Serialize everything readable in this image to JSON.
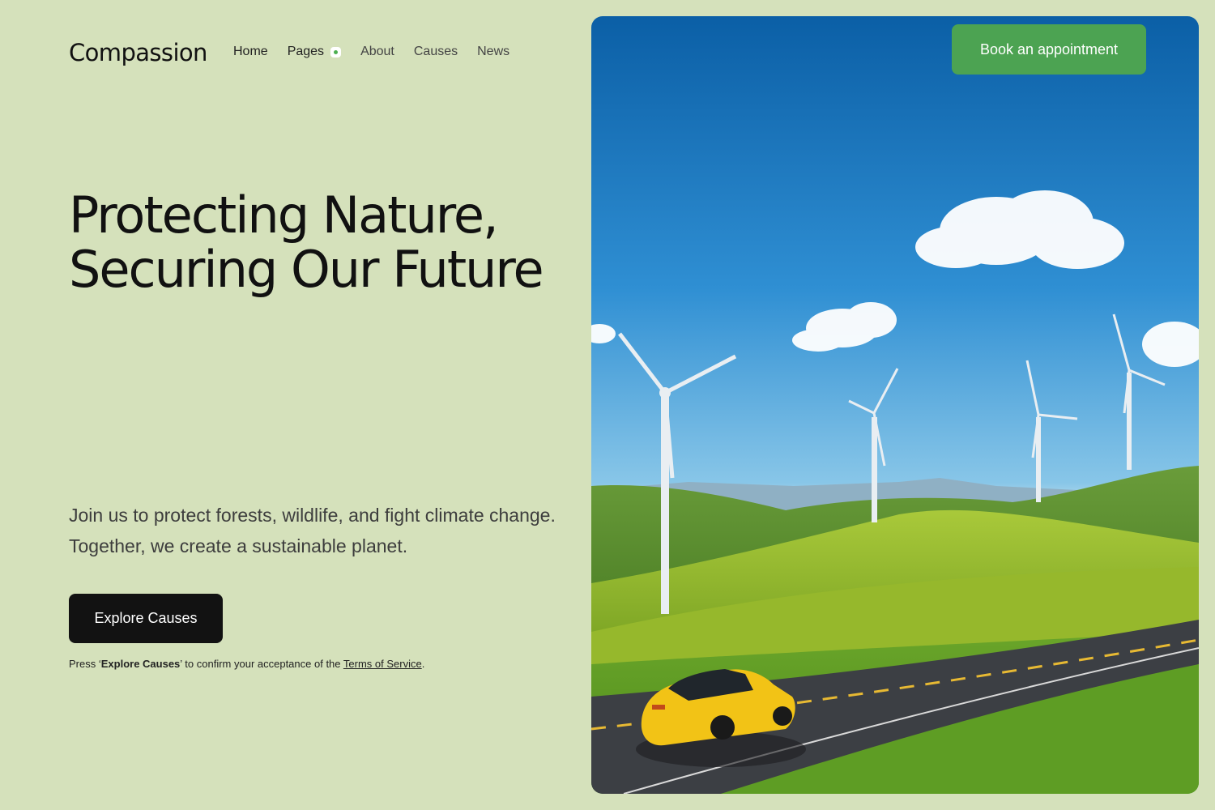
{
  "brand": {
    "name": "Compassion"
  },
  "nav": {
    "items": [
      {
        "label": "Home"
      },
      {
        "label": "Pages"
      },
      {
        "label": "About"
      },
      {
        "label": "Causes"
      },
      {
        "label": "News"
      }
    ]
  },
  "header": {
    "cta_label": "Book an appointment"
  },
  "hero": {
    "title_line1": "Protecting Nature,",
    "title_line2": "Securing Our Future",
    "subtitle_line1": "Join us to protect forests, wildlife, and fight climate change.",
    "subtitle_line2": "Together, we create a sustainable planet.",
    "cta_label": "Explore Causes",
    "terms_prefix": "Press ‘",
    "terms_cta": "Explore Causes",
    "terms_middle": "’ to confirm your acceptance of the ",
    "terms_link": "Terms of Service",
    "terms_suffix": "."
  },
  "colors": {
    "background": "#d5e1bb",
    "primary_button": "#121212",
    "accent_button": "#4ca352",
    "nav_dot": "#4caf50"
  },
  "icons": {
    "pages_indicator": "dot-indicator-icon"
  }
}
